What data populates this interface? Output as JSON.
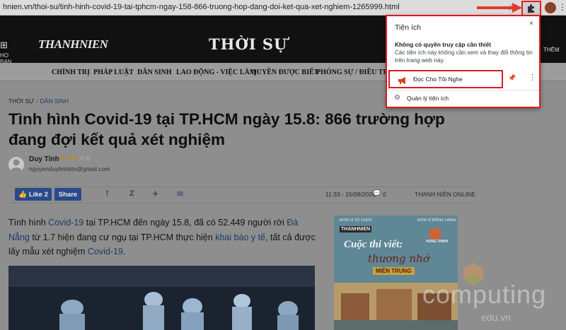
{
  "browser": {
    "url": "hnien.vn/thoi-su/tinh-hinh-covid-19-tai-tphcm-ngay-158-866-truong-hop-dang-doi-ket-qua-xet-nghiem-1265999.html"
  },
  "masthead": {
    "home_label": "HO BAN",
    "brand": "THANHNIEN",
    "section_title": "THỜI SỰ",
    "menu_label": "THÊM"
  },
  "nav": {
    "items": [
      "CHÍNH TRỊ",
      "PHÁP LUẬT",
      "DÂN SINH",
      "LAO ĐỘNG - VIỆC LÀM",
      "QUYỀN ĐƯỢC BIẾT",
      "PHÓNG SỰ / ĐIỀU TRA"
    ]
  },
  "article": {
    "breadcrumb_section": "THỜI SỰ",
    "breadcrumb_sep": "/",
    "breadcrumb_category": "DÂN SINH",
    "headline": "Tình hình Covid-19 tại TP.HCM ngày 15.8: 866 trường hợp đang đợi kết quả xét nghiệm",
    "author_name": "Duy Tính",
    "rating": 3,
    "rating_max": 5,
    "author_email": "nguyenduytinhbtn@gmail.com",
    "like_label": "Like 2",
    "share_label": "Share",
    "datetime": "11:33 - 15/08/2020",
    "comment_count": "0",
    "source": "THANH NIÊN ONLINE",
    "lead": {
      "t1": "Tình hình ",
      "l1": "Covid-19",
      "t2": " tại TP.HCM đến ngày 15.8, đã có 52.449 người rời ",
      "l2": "Đà Nẵng",
      "t3": " từ 1.7 hiện đang cư ngụ tại TP.HCM thực hiện ",
      "l3": "khai báo y tế",
      "t4": ", tất cả được lấy mẫu xét nghiệm ",
      "l4": "Covid-19",
      "t5": "."
    }
  },
  "ad": {
    "org1": "ĐƠN VỊ TỔ CHỨC",
    "org2": "ĐƠN VỊ ĐỒNG HÀNH",
    "brand1": "THANHNIEN",
    "brand2": "HUNG THINH",
    "title": "Cuộc thi viết:",
    "script": "thương nhớ",
    "region": "MIỀN TRUNG"
  },
  "watermark": {
    "main": "computing",
    "sub": "edu.vn"
  },
  "extensions_popup": {
    "title": "Tiện ích",
    "close": "×",
    "subhead": "Không có quyền truy cập cần thiết",
    "description": "Các tiện ích này không cần xem và thay đổi thông tin trên trang web này.",
    "extension_name": "Đọc Cho Tôi Nghe",
    "manage_label": "Quản lý tiện ích"
  },
  "colors": {
    "highlight_red": "#d91c1c",
    "link_blue": "#1d3a66",
    "facebook_blue": "#284a8a"
  }
}
